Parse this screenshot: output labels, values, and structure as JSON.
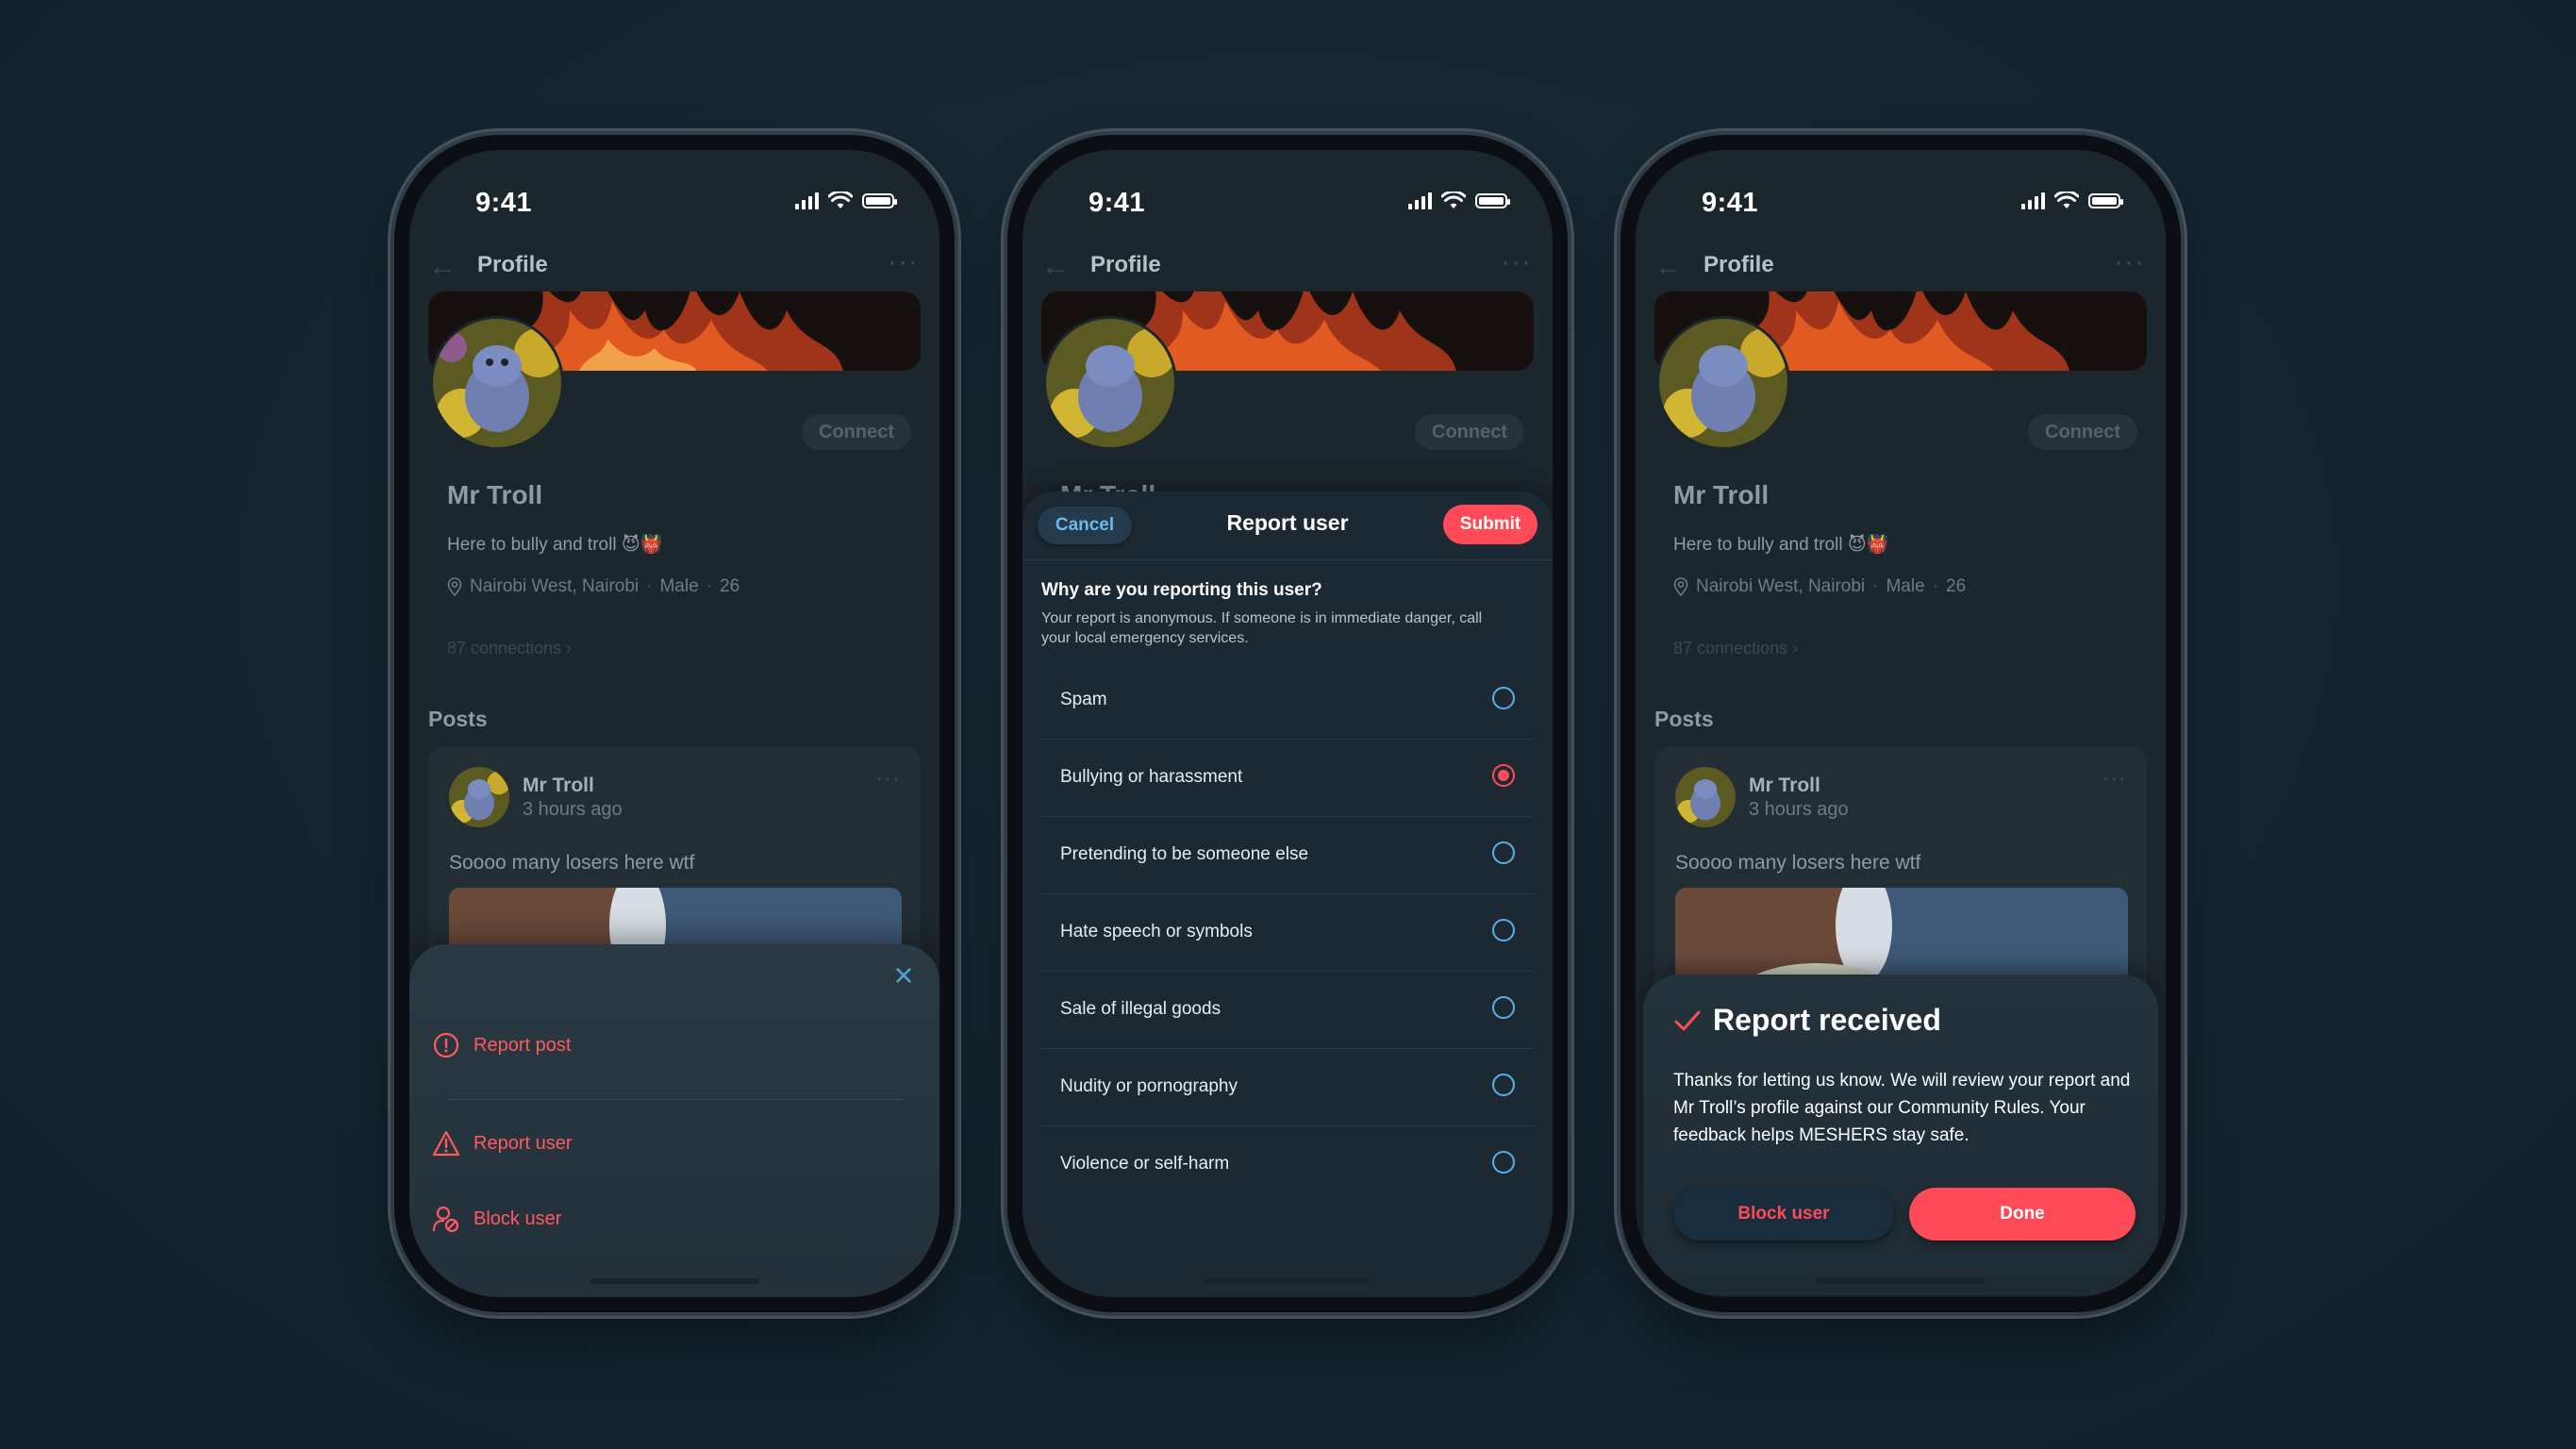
{
  "colors": {
    "background": "#152530",
    "accent_red": "#ff4b57",
    "accent_blue": "#5ab0e6"
  },
  "status": {
    "time": "9:41"
  },
  "profile": {
    "title": "Profile",
    "name": "Mr Troll",
    "bio": "Here to bully and troll 😈👹",
    "location": "Nairobi West, Nairobi",
    "gender": "Male",
    "age": "26",
    "connections": "87 connections ›",
    "connect_label": "Connect",
    "posts_heading": "Posts",
    "post": {
      "author": "Mr Troll",
      "time": "3 hours ago",
      "text": "Soooo many losers here wtf"
    }
  },
  "action_sheet": {
    "items": [
      {
        "label": "Report post",
        "icon": "alert-circle-icon"
      },
      {
        "label": "Report user",
        "icon": "warning-triangle-icon"
      },
      {
        "label": "Block user",
        "icon": "block-user-icon"
      }
    ]
  },
  "report_modal": {
    "cancel": "Cancel",
    "title": "Report user",
    "submit": "Submit",
    "question": "Why are you reporting this user?",
    "subtext": "Your report is anonymous. If someone is in immediate danger, call your local emergency services.",
    "options": [
      {
        "label": "Spam",
        "selected": false
      },
      {
        "label": "Bullying or harassment",
        "selected": true
      },
      {
        "label": "Pretending to be someone else",
        "selected": false
      },
      {
        "label": "Hate speech or symbols",
        "selected": false
      },
      {
        "label": "Sale of illegal goods",
        "selected": false
      },
      {
        "label": "Nudity or pornography",
        "selected": false
      },
      {
        "label": "Violence or self-harm",
        "selected": false
      }
    ]
  },
  "report_received": {
    "title": "Report received",
    "text": "Thanks for letting us know. We will review your report and Mr Troll’s profile against our Community Rules. Your feedback helps MESHERS stay safe.",
    "block": "Block user",
    "done": "Done"
  }
}
